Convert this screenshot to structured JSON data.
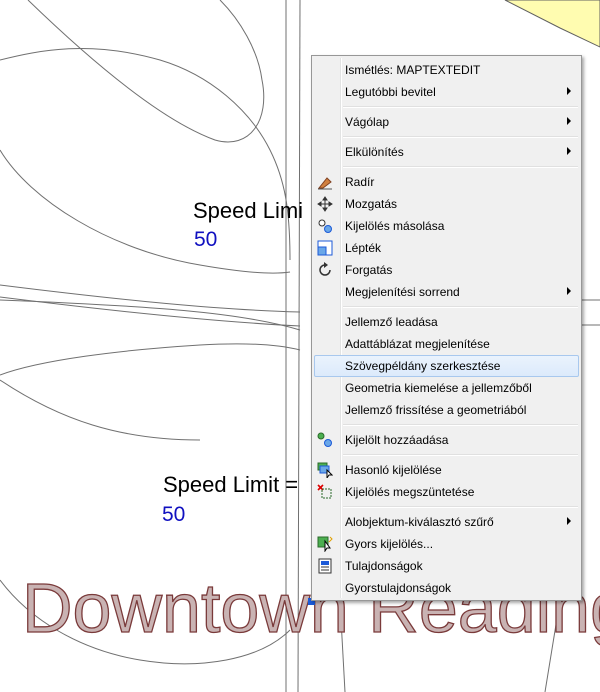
{
  "map": {
    "labels": [
      {
        "text": "Speed Limi",
        "class": "text"
      },
      {
        "text": "50",
        "class": "value"
      },
      {
        "text": "Speed Limit =",
        "class": "text"
      },
      {
        "text": "50",
        "class": "value"
      }
    ],
    "watermark": "Downtown Reading"
  },
  "menu": {
    "items": [
      {
        "label": "Ismétlés: MAPTEXTEDIT",
        "icon": "",
        "submenu": false
      },
      {
        "label": "Legutóbbi bevitel",
        "icon": "",
        "submenu": true
      },
      {
        "label": "Vágólap",
        "icon": "",
        "submenu": true
      },
      {
        "label": "Elkülönítés",
        "icon": "",
        "submenu": true
      },
      {
        "label": "Radír",
        "icon": "eraser-icon",
        "submenu": false
      },
      {
        "label": "Mozgatás",
        "icon": "move-icon",
        "submenu": false
      },
      {
        "label": "Kijelölés másolása",
        "icon": "copy-selection-icon",
        "submenu": false
      },
      {
        "label": "Lépték",
        "icon": "scale-icon",
        "submenu": false
      },
      {
        "label": "Forgatás",
        "icon": "rotate-icon",
        "submenu": false
      },
      {
        "label": "Megjelenítési sorrend",
        "icon": "",
        "submenu": true
      },
      {
        "label": "Jellemző leadása",
        "icon": "",
        "submenu": false
      },
      {
        "label": "Adattáblázat megjelenítése",
        "icon": "",
        "submenu": false
      },
      {
        "label": "Szövegpéldány szerkesztése",
        "icon": "",
        "submenu": false,
        "highlighted": true
      },
      {
        "label": "Geometria kiemelése a jellemzőből",
        "icon": "",
        "submenu": false
      },
      {
        "label": "Jellemző frissítése a geometriából",
        "icon": "",
        "submenu": false
      },
      {
        "label": "Kijelölt hozzáadása",
        "icon": "add-selected-icon",
        "submenu": false
      },
      {
        "label": "Hasonló kijelölése",
        "icon": "select-similar-icon",
        "submenu": false
      },
      {
        "label": "Kijelölés megszüntetése",
        "icon": "deselect-icon",
        "submenu": false
      },
      {
        "label": "Alobjektum-kiválasztó szűrő",
        "icon": "",
        "submenu": true
      },
      {
        "label": "Gyors kijelölés...",
        "icon": "quick-select-icon",
        "submenu": false
      },
      {
        "label": "Tulajdonságok",
        "icon": "properties-icon",
        "submenu": false
      },
      {
        "label": "Gyorstulajdonságok",
        "icon": "",
        "submenu": false
      }
    ]
  }
}
